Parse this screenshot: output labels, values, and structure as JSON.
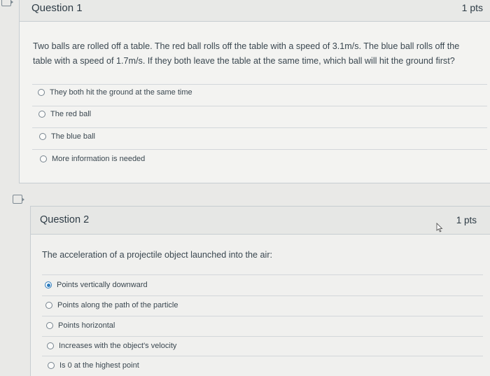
{
  "question1": {
    "title": "Question 1",
    "points": "1 pts",
    "text": "Two balls are rolled off a table. The red ball rolls off the table with a speed of 3.1m/s. The blue ball rolls off the table with a speed of 1.7m/s. If they both leave the table at the same time, which ball will hit the ground first?",
    "answers": [
      {
        "label": "They both hit the ground at the same time",
        "selected": false
      },
      {
        "label": "The red ball",
        "selected": false
      },
      {
        "label": "The blue ball",
        "selected": false
      },
      {
        "label": "More information is needed",
        "selected": false
      }
    ]
  },
  "question2": {
    "title": "Question 2",
    "points": "1 pts",
    "text": "The acceleration of a projectile object launched into the air:",
    "answers": [
      {
        "label": "Points vertically downward",
        "selected": true
      },
      {
        "label": "Points along the path of the particle",
        "selected": false
      },
      {
        "label": "Points horizontal",
        "selected": false
      },
      {
        "label": "Increases with the object's velocity",
        "selected": false
      },
      {
        "label": "Is 0 at the highest point",
        "selected": false
      }
    ]
  },
  "colors": {
    "accent": "#2b7abc",
    "border": "#c7cdd1",
    "text": "#2d3b45"
  }
}
